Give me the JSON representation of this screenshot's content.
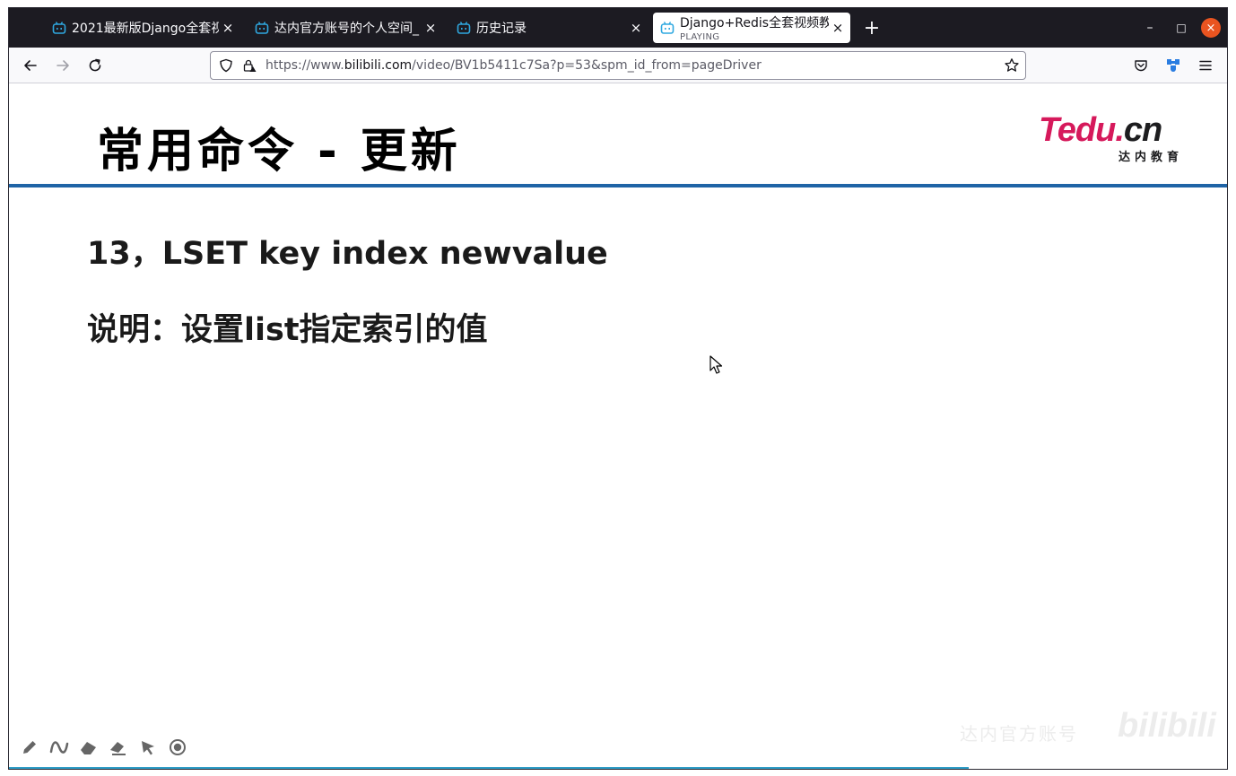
{
  "browser": {
    "tabs": [
      {
        "title": "2021最新版Django全套视",
        "active": false
      },
      {
        "title": "达内官方账号的个人空间_",
        "active": false
      },
      {
        "title": "历史记录",
        "active": false
      },
      {
        "title": "Django+Redis全套视频教",
        "subtitle": "PLAYING",
        "active": true
      }
    ],
    "new_tab_label": "+",
    "close_glyph": "×",
    "url_prefix": "https://www.",
    "url_domain": "bilibili.com",
    "url_path": "/video/BV1b5411c7Sa?p=53&spm_id_from=pageDriver",
    "window_controls": {
      "minimize": "–",
      "maximize": "□",
      "close": "×"
    },
    "icons": {
      "back": "arrow-left-icon",
      "forward": "arrow-right-icon",
      "reload": "reload-icon",
      "shield": "tracking-protection-shield-icon",
      "lock": "lock-warning-icon",
      "bookmark": "star-icon",
      "pocket": "pocket-icon",
      "extension": "extension-icon",
      "menu": "hamburger-menu-icon"
    },
    "accent_color": "#e95420"
  },
  "slide": {
    "title": "常用命令 - 更新",
    "logo_main": "Tedu.",
    "logo_main_cn": "cn",
    "logo_sub": "达内教育",
    "line1": "13，LSET key index newvalue",
    "line2": "说明：设置list指定索引的值",
    "rule_color": "#1f64a6",
    "logo_color": "#d6195b"
  },
  "player": {
    "tools": [
      "pen-icon",
      "curve-icon",
      "highlighter-icon",
      "eraser-icon",
      "pointer-icon",
      "record-icon"
    ],
    "watermark_text": "达内官方账号",
    "watermark_logo": "bilibili",
    "progress_color": "#2f9dc7"
  }
}
